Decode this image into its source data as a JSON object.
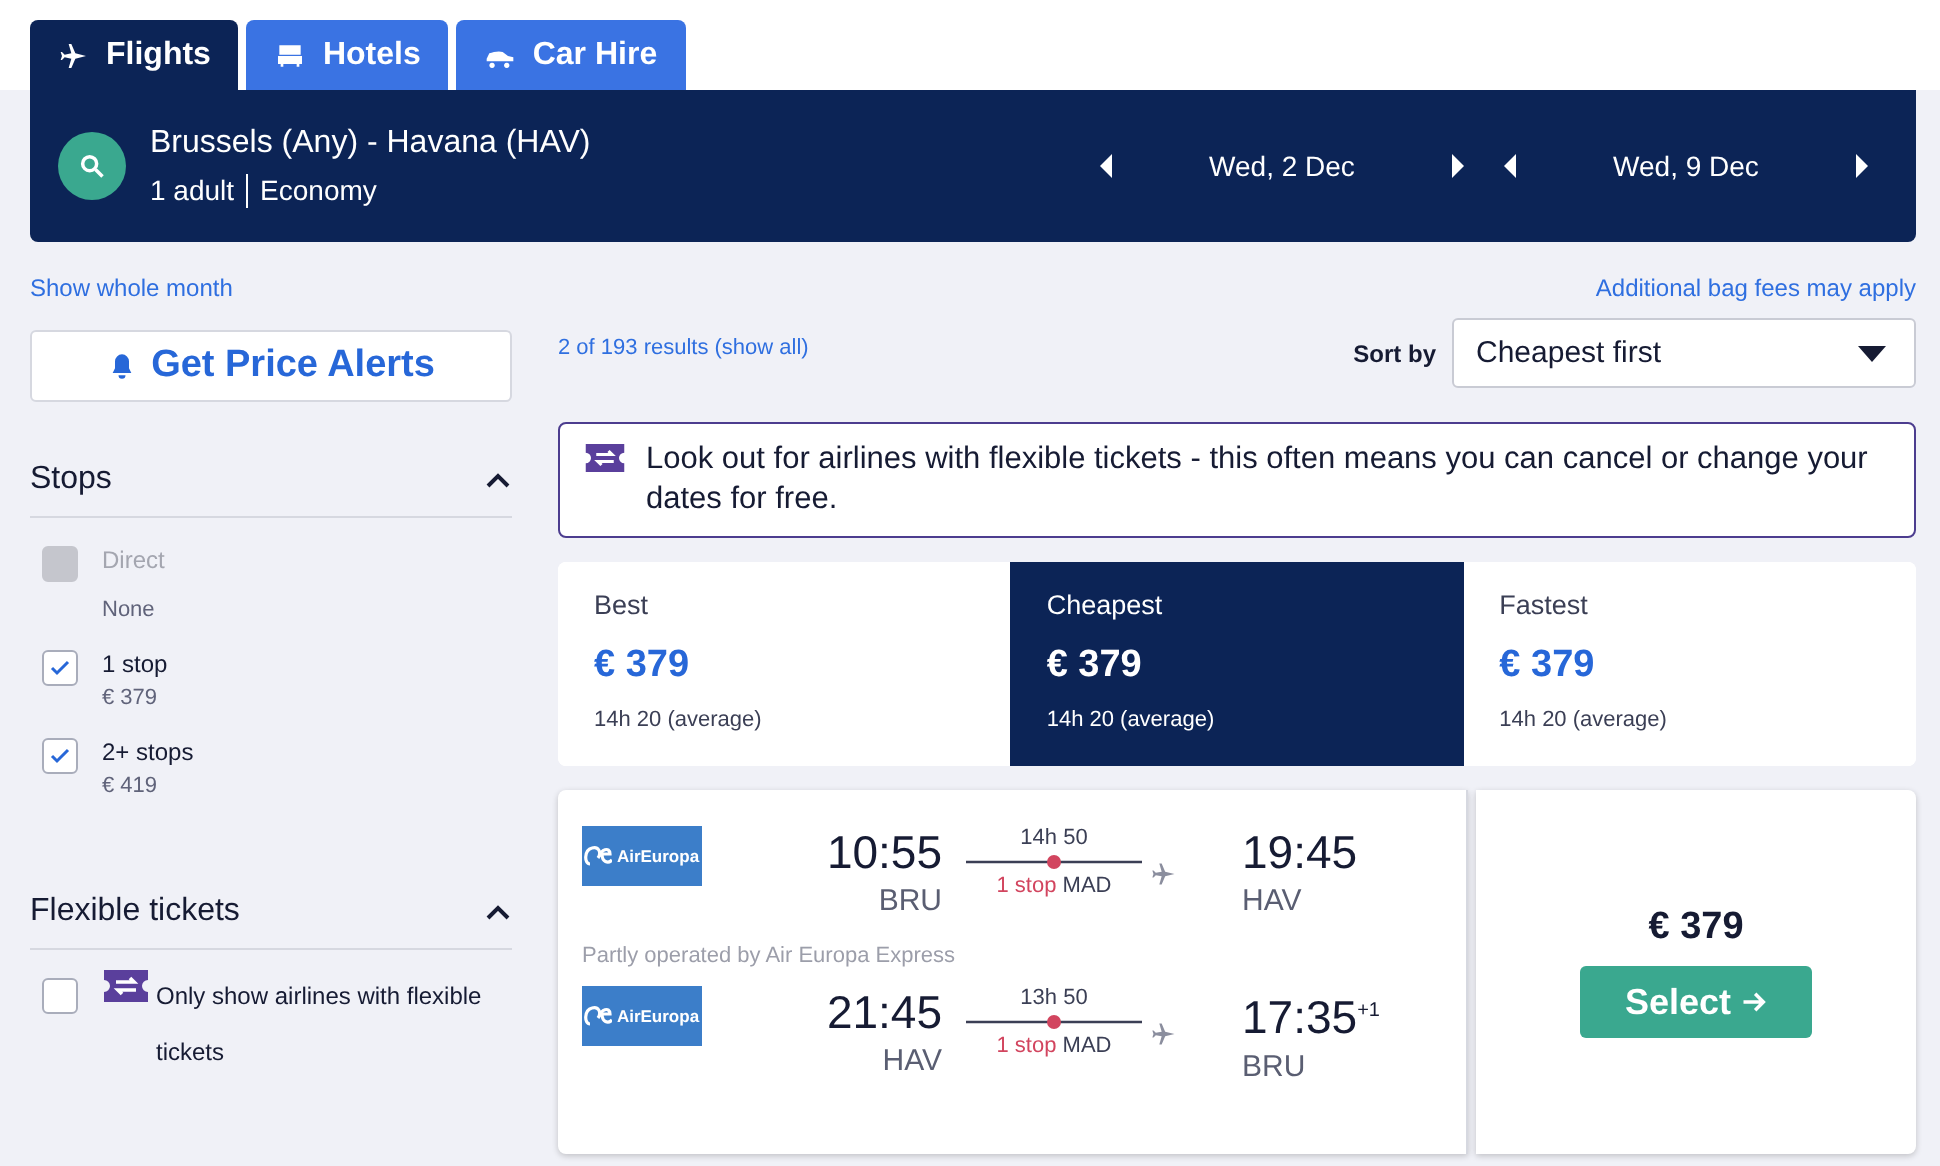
{
  "tabs": [
    {
      "label": "Flights",
      "selected": true
    },
    {
      "label": "Hotels",
      "selected": false
    },
    {
      "label": "Car Hire",
      "selected": false
    }
  ],
  "search": {
    "route": "Brussels (Any) - Havana (HAV)",
    "passengers": "1 adult",
    "cabin": "Economy",
    "dates": [
      "Wed, 2 Dec",
      "Wed, 9 Dec"
    ]
  },
  "show_whole_month": "Show whole month",
  "bag_fees": "Additional bag fees may apply",
  "price_alert_button": "Get Price Alerts",
  "results_count": "2 of 193 results (show all)",
  "sort": {
    "label": "Sort by",
    "value": "Cheapest first"
  },
  "filters": [
    {
      "title": "Stops",
      "expanded": true,
      "options": [
        {
          "label": "Direct",
          "sub": "None",
          "checked": false,
          "disabled": true
        },
        {
          "label": "1 stop",
          "sub": "€ 379",
          "checked": true,
          "disabled": false
        },
        {
          "label": "2+ stops",
          "sub": "€ 419",
          "checked": true,
          "disabled": false
        }
      ]
    },
    {
      "title": "Flexible tickets",
      "expanded": true,
      "options": [
        {
          "label": "Only show airlines with flexible tickets",
          "checked": false,
          "disabled": false,
          "flexible_icon": true
        }
      ]
    }
  ],
  "notice": "Look out for airlines with flexible tickets - this often means you can cancel or change your dates for free.",
  "sort_tabs": [
    {
      "label": "Best",
      "price": "€ 379",
      "duration": "14h 20 (average)",
      "selected": false
    },
    {
      "label": "Cheapest",
      "price": "€ 379",
      "duration": "14h 20 (average)",
      "selected": true
    },
    {
      "label": "Fastest",
      "price": "€ 379",
      "duration": "14h 20 (average)",
      "selected": false
    }
  ],
  "result": {
    "legs": [
      {
        "airline": "AirEuropa",
        "depart_time": "10:55",
        "depart_airport": "BRU",
        "duration": "14h 50",
        "stops": "1 stop",
        "via": "MAD",
        "arrive_time": "19:45",
        "arrive_airport": "HAV"
      },
      {
        "airline": "AirEuropa",
        "depart_time": "21:45",
        "depart_airport": "HAV",
        "duration": "13h 50",
        "stops": "1 stop",
        "via": "MAD",
        "arrive_time": "17:35",
        "day_offset": "+1",
        "arrive_airport": "BRU"
      }
    ],
    "operated_note": "Partly operated by Air Europa Express",
    "price": "€ 379",
    "select_button": "Select"
  }
}
